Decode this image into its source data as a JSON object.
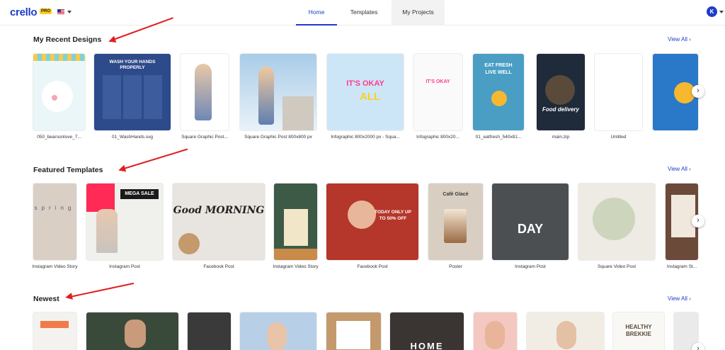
{
  "header": {
    "logo": "crello",
    "pro_badge": "PRO",
    "nav": [
      "Home",
      "Templates",
      "My Projects"
    ],
    "avatar_initial": "K"
  },
  "recent": {
    "title": "My Recent Designs",
    "view_all": "View All",
    "items": [
      {
        "caption": "050_bearsonlove_7...",
        "overlay": ""
      },
      {
        "caption": "01_WashHands.svg",
        "overlay": "WASH YOUR HANDS PROPERLY"
      },
      {
        "caption": "Square Graphic Post...",
        "overlay": ""
      },
      {
        "caption": "Square Graphic Post 800x800 px",
        "overlay": ""
      },
      {
        "caption": "Infographic 800x2000 px - Squa...",
        "overlay": "IT'S OKAY"
      },
      {
        "caption": "Infographic 800x20...",
        "overlay": "IT'S OKAY"
      },
      {
        "caption": "01_eatfresh_540x81...",
        "overlay": "EAT FRESH LIVE WELL"
      },
      {
        "caption": "main.zip",
        "overlay": "Food delivery"
      },
      {
        "caption": "Untitled",
        "overlay": ""
      }
    ]
  },
  "featured": {
    "title": "Featured Templates",
    "view_all": "View All",
    "items": [
      {
        "caption": "Instagram Video Story",
        "overlay": "spring"
      },
      {
        "caption": "Instagram Post",
        "overlay": "MEGA SALE"
      },
      {
        "caption": "Facebook Post",
        "overlay": "Good MORNING"
      },
      {
        "caption": "Instagram Video Story",
        "overlay": ""
      },
      {
        "caption": "Facebook Post",
        "overlay": "TODAY ONLY UP TO 50% OFF"
      },
      {
        "caption": "Poster",
        "overlay": "Café Glacé"
      },
      {
        "caption": "Instagram Post",
        "overlay": "DAY"
      },
      {
        "caption": "Square Video Post",
        "overlay": ""
      },
      {
        "caption": "Instagram St...",
        "overlay": ""
      }
    ]
  },
  "newest": {
    "title": "Newest",
    "view_all": "View All",
    "items": [
      {
        "overlay": ""
      },
      {
        "overlay": ""
      },
      {
        "overlay": ""
      },
      {
        "overlay": ""
      },
      {
        "overlay": ""
      },
      {
        "overlay": "HOME"
      },
      {
        "overlay": ""
      },
      {
        "overlay": ""
      },
      {
        "overlay": "HEALTHY BREKKIE"
      }
    ]
  },
  "colors": {
    "brand": "#1e3cc8",
    "annotation_arrow": "#e02020"
  }
}
